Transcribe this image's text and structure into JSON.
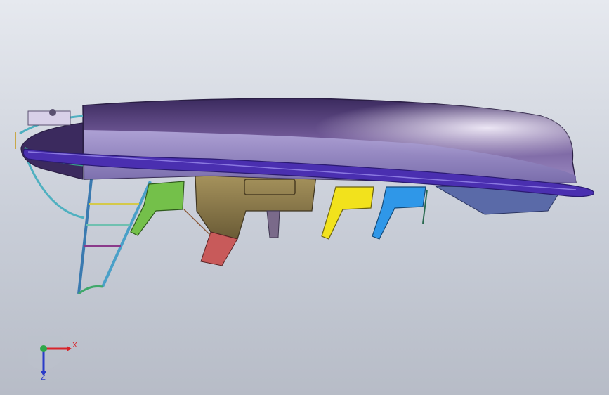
{
  "view": {
    "background_top": "#e6e9ef",
    "background_bottom": "#b7bcc7"
  },
  "model": {
    "hull_color": "#6f5896",
    "hull_highlight": "#e8dcf2",
    "rail_color": "#4a2fb0",
    "engine_color": "#8c7a4a",
    "seat_colors": [
      "#74c04a",
      "#f2e21c",
      "#2f97e8"
    ],
    "ladder_color": "#4aa0c8"
  },
  "triad": {
    "x_label": "X",
    "z_label": "Z",
    "x_color": "#d8242a",
    "y_color": "#2ea84a",
    "z_color": "#2a3cc8"
  }
}
